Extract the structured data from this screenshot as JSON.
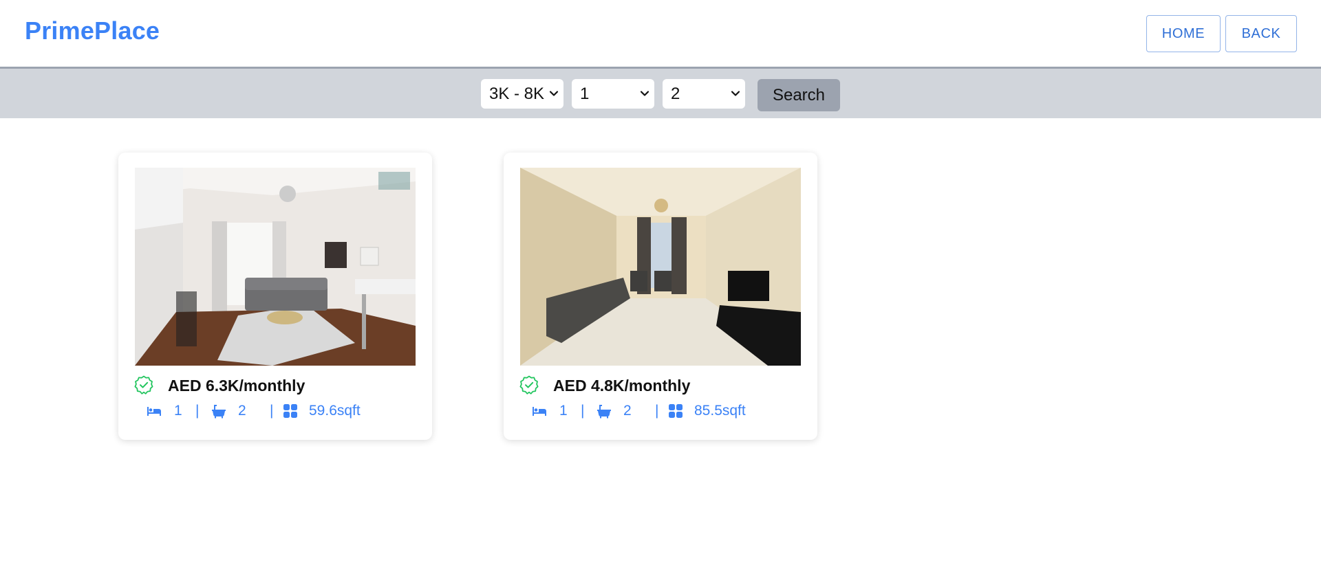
{
  "header": {
    "brand": "PrimePlace",
    "home_label": "HOME",
    "back_label": "BACK"
  },
  "filters": {
    "price_range": "3K - 8K",
    "bedrooms": "1",
    "bathrooms": "2",
    "search_label": "Search"
  },
  "listings": [
    {
      "price": "AED 6.3K/monthly",
      "beds": "1",
      "baths": "2",
      "area": "59.6sqft",
      "separator": "|"
    },
    {
      "price": "AED 4.8K/monthly",
      "beds": "1",
      "baths": "2",
      "area": "85.5sqft",
      "separator": "|"
    }
  ],
  "icons": {
    "verified": "verified-badge-icon",
    "bed": "bed-icon",
    "bath": "bathtub-icon",
    "area": "grid-area-icon",
    "chevron": "chevron-down-icon"
  },
  "colors": {
    "brand": "#3b82f6",
    "verified": "#22c55e",
    "filter_bar": "#d1d5db",
    "search_button": "#9ca3af"
  }
}
